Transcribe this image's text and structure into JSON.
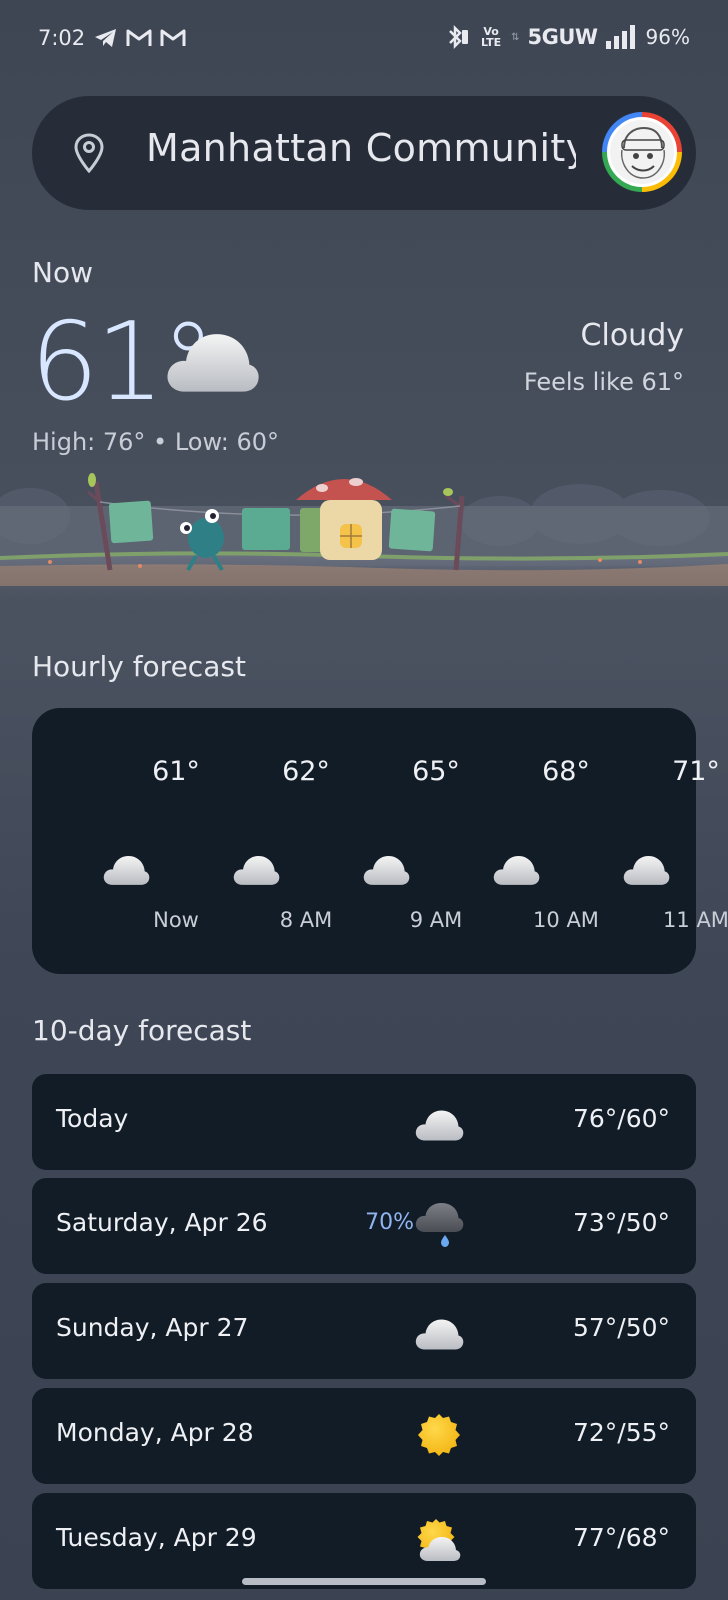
{
  "status_bar": {
    "time": "7:02",
    "network": "5GUW",
    "volte": "Vo LTE",
    "battery": "96%",
    "icons": [
      "telegram-icon",
      "gmail-icon",
      "gmail-icon",
      "bluetooth-icon",
      "volte-icon",
      "signal-icon"
    ]
  },
  "search": {
    "location": "Manhattan Community ...",
    "pin_icon": "location-pin-icon"
  },
  "current": {
    "label": "Now",
    "temp": "61°",
    "condition": "Cloudy",
    "feels_like": "Feels like 61°",
    "high_low": "High: 76° • Low: 60°",
    "icon": "cloud-icon"
  },
  "hourly": {
    "title": "Hourly forecast",
    "items": [
      {
        "temp": "61°",
        "time": "Now",
        "icon": "cloud-icon"
      },
      {
        "temp": "62°",
        "time": "8 AM",
        "icon": "cloud-icon"
      },
      {
        "temp": "65°",
        "time": "9 AM",
        "icon": "cloud-icon"
      },
      {
        "temp": "68°",
        "time": "10 AM",
        "icon": "cloud-icon"
      },
      {
        "temp": "71°",
        "time": "11 AM",
        "icon": "cloud-icon"
      }
    ]
  },
  "daily": {
    "title": "10-day forecast",
    "items": [
      {
        "day": "Today",
        "precip": "",
        "icon": "cloud-icon",
        "temps": "76°/60°"
      },
      {
        "day": "Saturday, Apr 26",
        "precip": "70%",
        "icon": "rain-cloud-icon",
        "temps": "73°/50°"
      },
      {
        "day": "Sunday, Apr 27",
        "precip": "",
        "icon": "cloud-icon",
        "temps": "57°/50°"
      },
      {
        "day": "Monday, Apr 28",
        "precip": "",
        "icon": "sun-icon",
        "temps": "72°/55°"
      },
      {
        "day": "Tuesday, Apr 29",
        "precip": "",
        "icon": "partly-cloudy-icon",
        "temps": "77°/68°"
      }
    ]
  },
  "colors": {
    "card_bg": "#121c27",
    "search_bg": "#262d38",
    "accent_temp": "#d8e6ff",
    "precip": "#8fb4f0",
    "sun": "#f7c21f"
  }
}
